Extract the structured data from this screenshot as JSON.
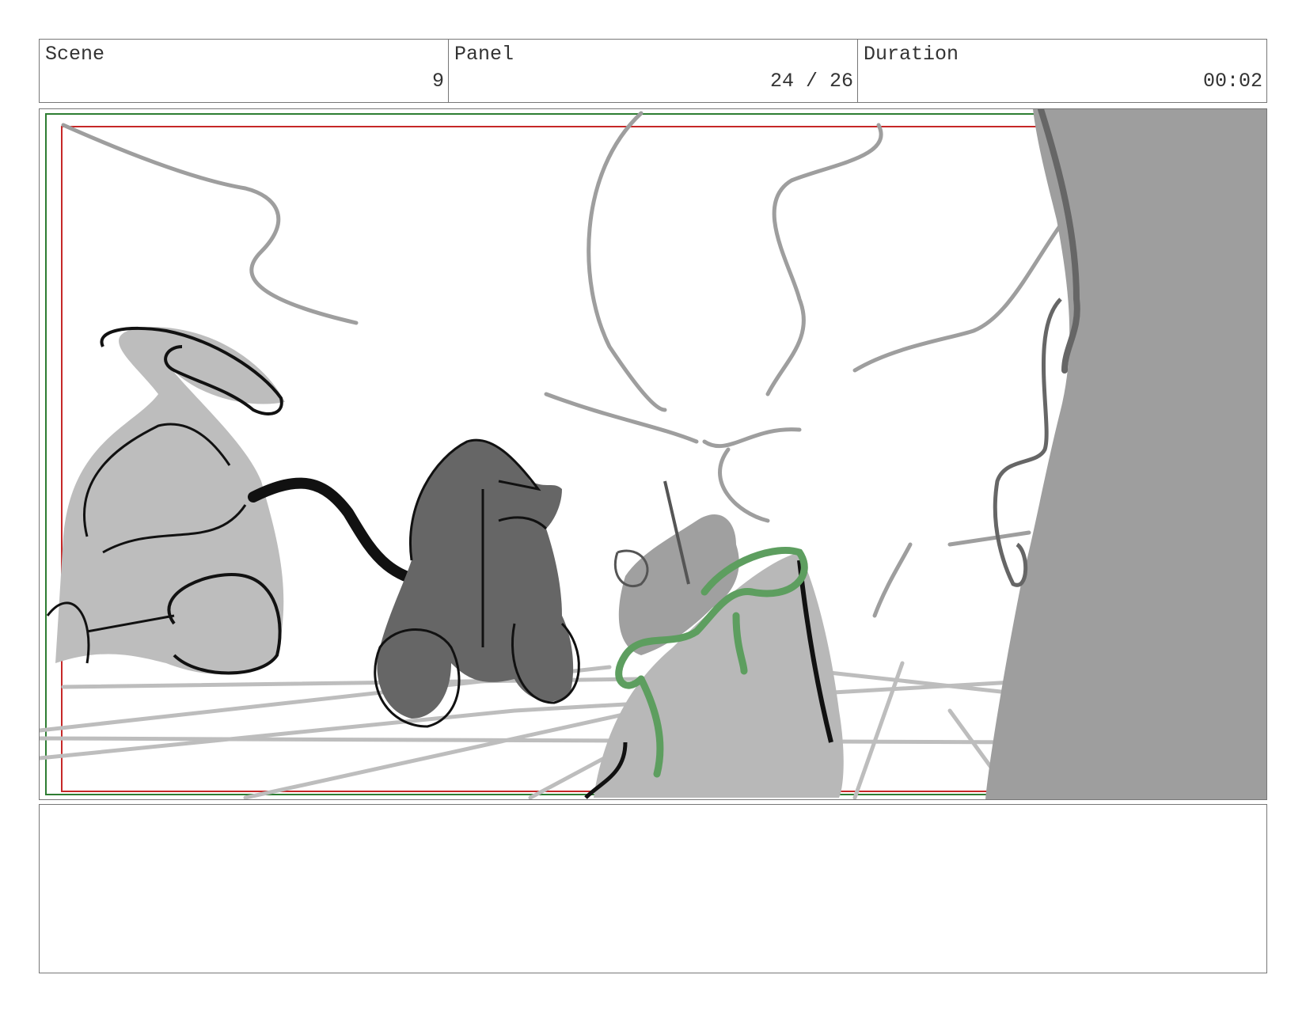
{
  "header": {
    "scene": {
      "label": "Scene",
      "value": "9"
    },
    "panel": {
      "label": "Panel",
      "value": "24 / 26"
    },
    "duration": {
      "label": "Duration",
      "value": "00:02"
    }
  },
  "frame": {
    "colors": {
      "safe_outer": "#2e7d32",
      "safe_inner": "#c62828",
      "sketch_light": "#b3b3b3",
      "sketch_dark": "#666666",
      "ink": "#111111",
      "accent": "#5d9e5f"
    }
  },
  "notes": {
    "text": ""
  }
}
